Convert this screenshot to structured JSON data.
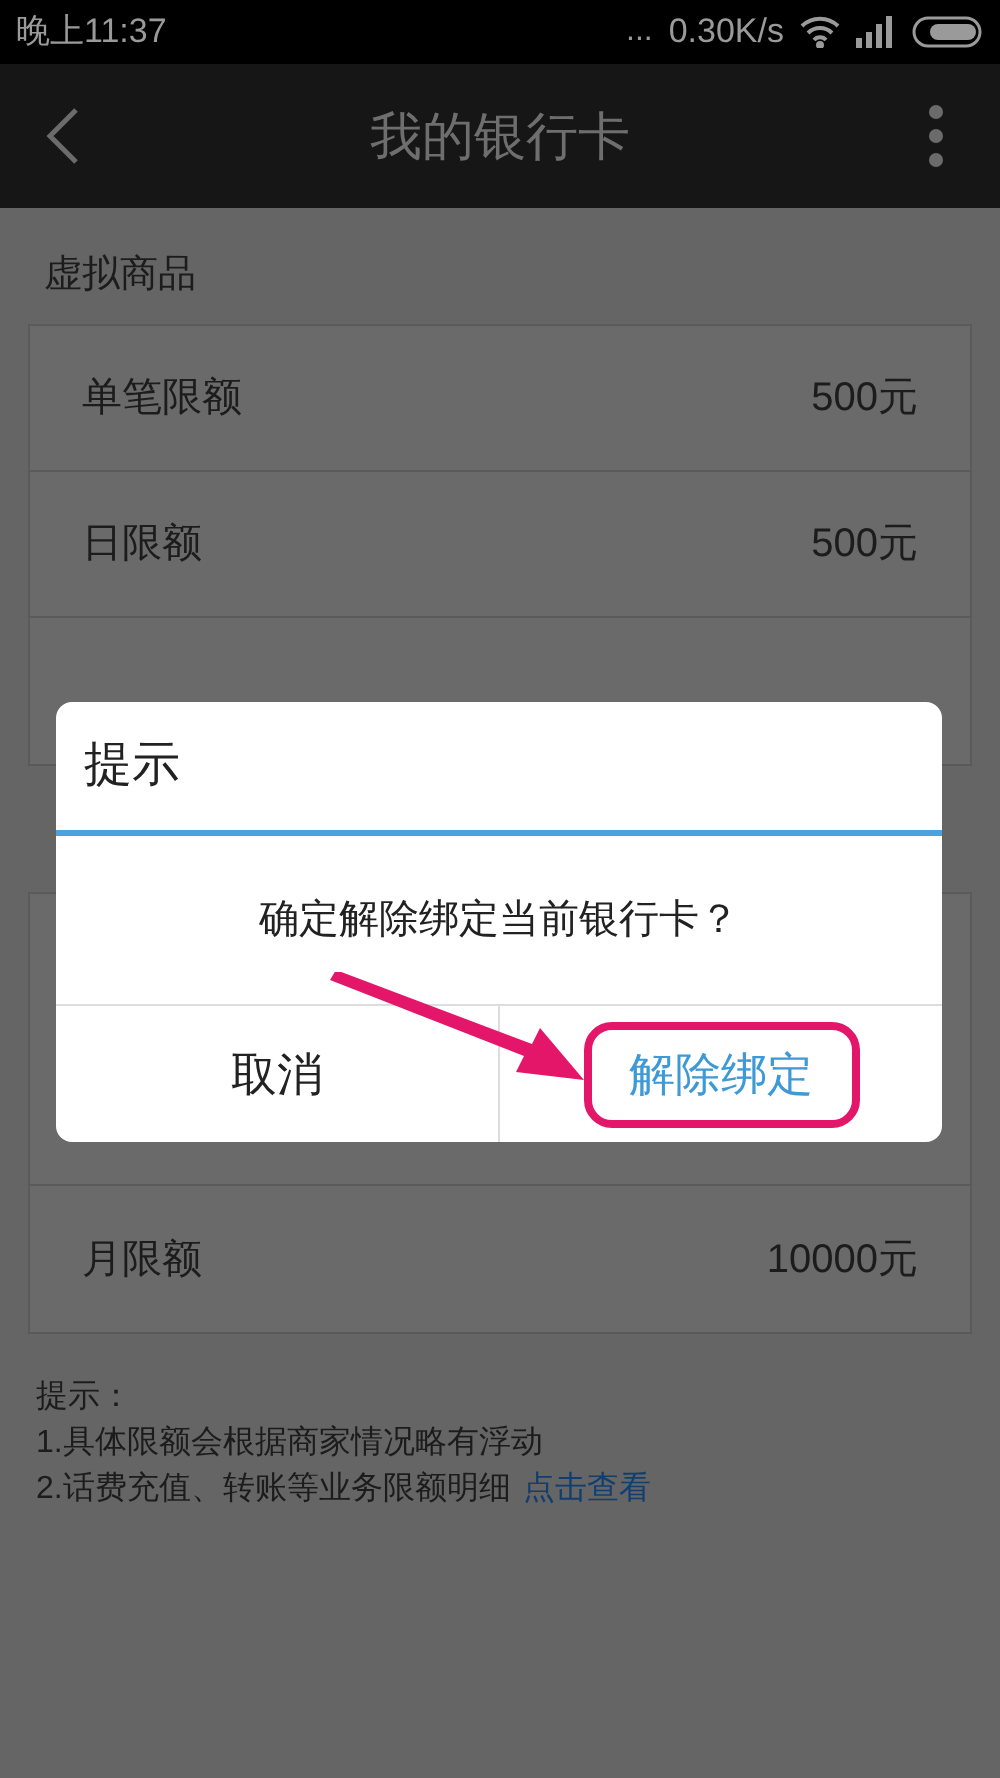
{
  "status_bar": {
    "time": "晚上11:37",
    "dots": "...",
    "speed": "0.30K/s"
  },
  "header": {
    "title": "我的银行卡"
  },
  "sections": [
    {
      "title": "虚拟商品",
      "rows": [
        {
          "label": "单笔限额",
          "value": "500元"
        },
        {
          "label": "日限额",
          "value": "500元"
        }
      ]
    },
    {
      "rows": [
        {
          "label": "月限额",
          "value": "10000元"
        }
      ]
    }
  ],
  "notes": {
    "title": "提示：",
    "lines": [
      {
        "text": "1.具体限额会根据商家情况略有浮动"
      },
      {
        "text": "2.话费充值、转账等业务限额明细",
        "link": "点击查看"
      }
    ]
  },
  "dialog": {
    "title": "提示",
    "message": "确定解除绑定当前银行卡？",
    "buttons": [
      {
        "label": "取消",
        "kind": "cancel",
        "highlighted": false
      },
      {
        "label": "解除绑定",
        "kind": "confirm",
        "highlighted": true
      }
    ]
  }
}
